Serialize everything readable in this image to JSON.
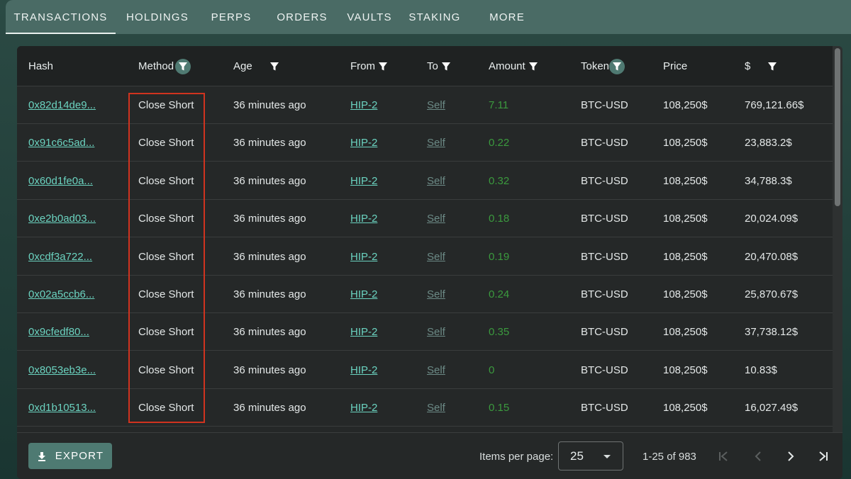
{
  "tabs": [
    {
      "label": "TRANSACTIONS",
      "active": true
    },
    {
      "label": "HOLDINGS",
      "active": false
    },
    {
      "label": "PERPS",
      "active": false
    },
    {
      "label": "ORDERS",
      "active": false
    },
    {
      "label": "VAULTS",
      "active": false
    },
    {
      "label": "STAKING",
      "active": false
    },
    {
      "label": "MORE",
      "active": false
    }
  ],
  "table": {
    "columns": [
      {
        "label": "Hash",
        "filter": "none"
      },
      {
        "label": "Method",
        "filter": "active"
      },
      {
        "label": "Age",
        "filter": "inactive"
      },
      {
        "label": "From",
        "filter": "inactive"
      },
      {
        "label": "To",
        "filter": "inactive"
      },
      {
        "label": "Amount",
        "filter": "inactive"
      },
      {
        "label": "Token",
        "filter": "active"
      },
      {
        "label": "Price",
        "filter": "none"
      },
      {
        "label": "$",
        "filter": "inactive"
      }
    ],
    "rows": [
      {
        "hash": "0x82d14de9...",
        "method": "Close Short",
        "age": "36 minutes ago",
        "from": "HIP-2",
        "to": "Self",
        "amount": "7.11",
        "token": "BTC-USD",
        "price": "108,250$",
        "usd": "769,121.66$"
      },
      {
        "hash": "0x91c6c5ad...",
        "method": "Close Short",
        "age": "36 minutes ago",
        "from": "HIP-2",
        "to": "Self",
        "amount": "0.22",
        "token": "BTC-USD",
        "price": "108,250$",
        "usd": "23,883.2$"
      },
      {
        "hash": "0x60d1fe0a...",
        "method": "Close Short",
        "age": "36 minutes ago",
        "from": "HIP-2",
        "to": "Self",
        "amount": "0.32",
        "token": "BTC-USD",
        "price": "108,250$",
        "usd": "34,788.3$"
      },
      {
        "hash": "0xe2b0ad03...",
        "method": "Close Short",
        "age": "36 minutes ago",
        "from": "HIP-2",
        "to": "Self",
        "amount": "0.18",
        "token": "BTC-USD",
        "price": "108,250$",
        "usd": "20,024.09$"
      },
      {
        "hash": "0xcdf3a722...",
        "method": "Close Short",
        "age": "36 minutes ago",
        "from": "HIP-2",
        "to": "Self",
        "amount": "0.19",
        "token": "BTC-USD",
        "price": "108,250$",
        "usd": "20,470.08$"
      },
      {
        "hash": "0x02a5ccb6...",
        "method": "Close Short",
        "age": "36 minutes ago",
        "from": "HIP-2",
        "to": "Self",
        "amount": "0.24",
        "token": "BTC-USD",
        "price": "108,250$",
        "usd": "25,870.67$"
      },
      {
        "hash": "0x9cfedf80...",
        "method": "Close Short",
        "age": "36 minutes ago",
        "from": "HIP-2",
        "to": "Self",
        "amount": "0.35",
        "token": "BTC-USD",
        "price": "108,250$",
        "usd": "37,738.12$"
      },
      {
        "hash": "0x8053eb3e...",
        "method": "Close Short",
        "age": "36 minutes ago",
        "from": "HIP-2",
        "to": "Self",
        "amount": "0",
        "token": "BTC-USD",
        "price": "108,250$",
        "usd": "10.83$"
      },
      {
        "hash": "0xd1b10513...",
        "method": "Close Short",
        "age": "36 minutes ago",
        "from": "HIP-2",
        "to": "Self",
        "amount": "0.15",
        "token": "BTC-USD",
        "price": "108,250$",
        "usd": "16,027.49$"
      }
    ]
  },
  "footer": {
    "export_label": "EXPORT",
    "export_icon": "download-icon",
    "items_per_page_label": "Items per page:",
    "items_per_page_value": "25",
    "range_label": "1-25 of 983"
  },
  "colors": {
    "tab_bar": "#4a6b65",
    "link": "#6bd3c0",
    "amount": "#3b9a3e",
    "highlight_box": "#d0331f",
    "export_button": "#4e7a72"
  }
}
